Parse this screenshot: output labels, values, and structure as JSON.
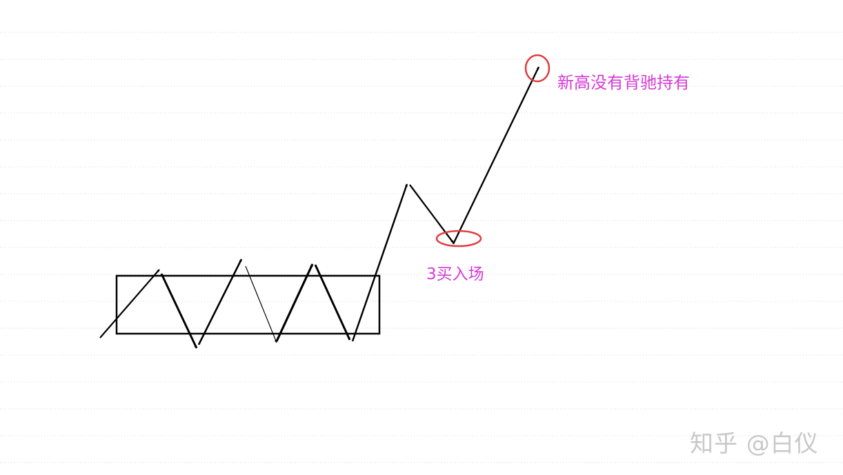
{
  "annotations": {
    "new_high_note": "新高没有背驰持有",
    "third_buy_note": "3买入场"
  },
  "watermark": "知乎 @白仪",
  "colors": {
    "annotation_text": "#d63ad6",
    "marker_ellipse": "#e0393e",
    "lines": "#000000",
    "grid": "#d0d0d0",
    "watermark": "#c8c8c8"
  },
  "icons": {
    "arrowhead": "arrowhead-icon"
  }
}
